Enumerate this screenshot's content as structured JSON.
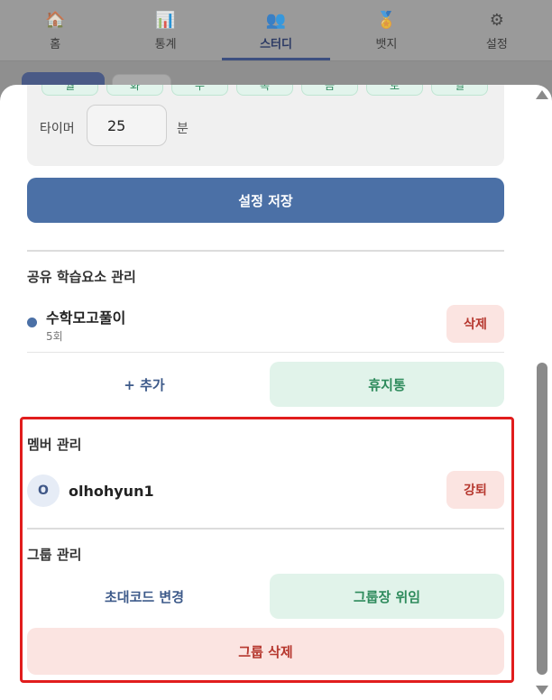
{
  "nav": {
    "items": [
      {
        "label": "홈",
        "icon": "home-icon",
        "glyph": "🏠"
      },
      {
        "label": "통계",
        "icon": "chart-icon",
        "glyph": "📊"
      },
      {
        "label": "스터디",
        "icon": "people-icon",
        "glyph": "👥"
      },
      {
        "label": "뱃지",
        "icon": "medal-icon",
        "glyph": "🏅"
      },
      {
        "label": "설정",
        "icon": "gear-icon",
        "glyph": "⚙"
      }
    ],
    "active": "스터디"
  },
  "settings": {
    "days": [
      "월",
      "화",
      "수",
      "목",
      "금",
      "토",
      "일"
    ],
    "timer_label": "타이머",
    "timer_value": "25",
    "timer_unit": "분",
    "save_label": "설정 저장"
  },
  "shared": {
    "title": "공유 학습요소 관리",
    "items": [
      {
        "name": "수학모고풀이",
        "count": "5회",
        "delete_label": "삭제"
      }
    ],
    "add_label": "+ 추가",
    "trash_label": "휴지통"
  },
  "members": {
    "title": "멤버 관리",
    "list": [
      {
        "initial": "O",
        "name": "olhohyun1",
        "kick_label": "강퇴"
      }
    ]
  },
  "group": {
    "title": "그룹 관리",
    "change_code_label": "초대코드 변경",
    "transfer_label": "그룹장 위임",
    "delete_label": "그룹 삭제"
  },
  "colors": {
    "primary": "#4b70a6",
    "danger_bg": "#fbe4e1",
    "danger_text": "#b6372e",
    "success_bg": "#e1f3ea",
    "success_text": "#2e8b5c",
    "highlight": "#e11d1d"
  }
}
